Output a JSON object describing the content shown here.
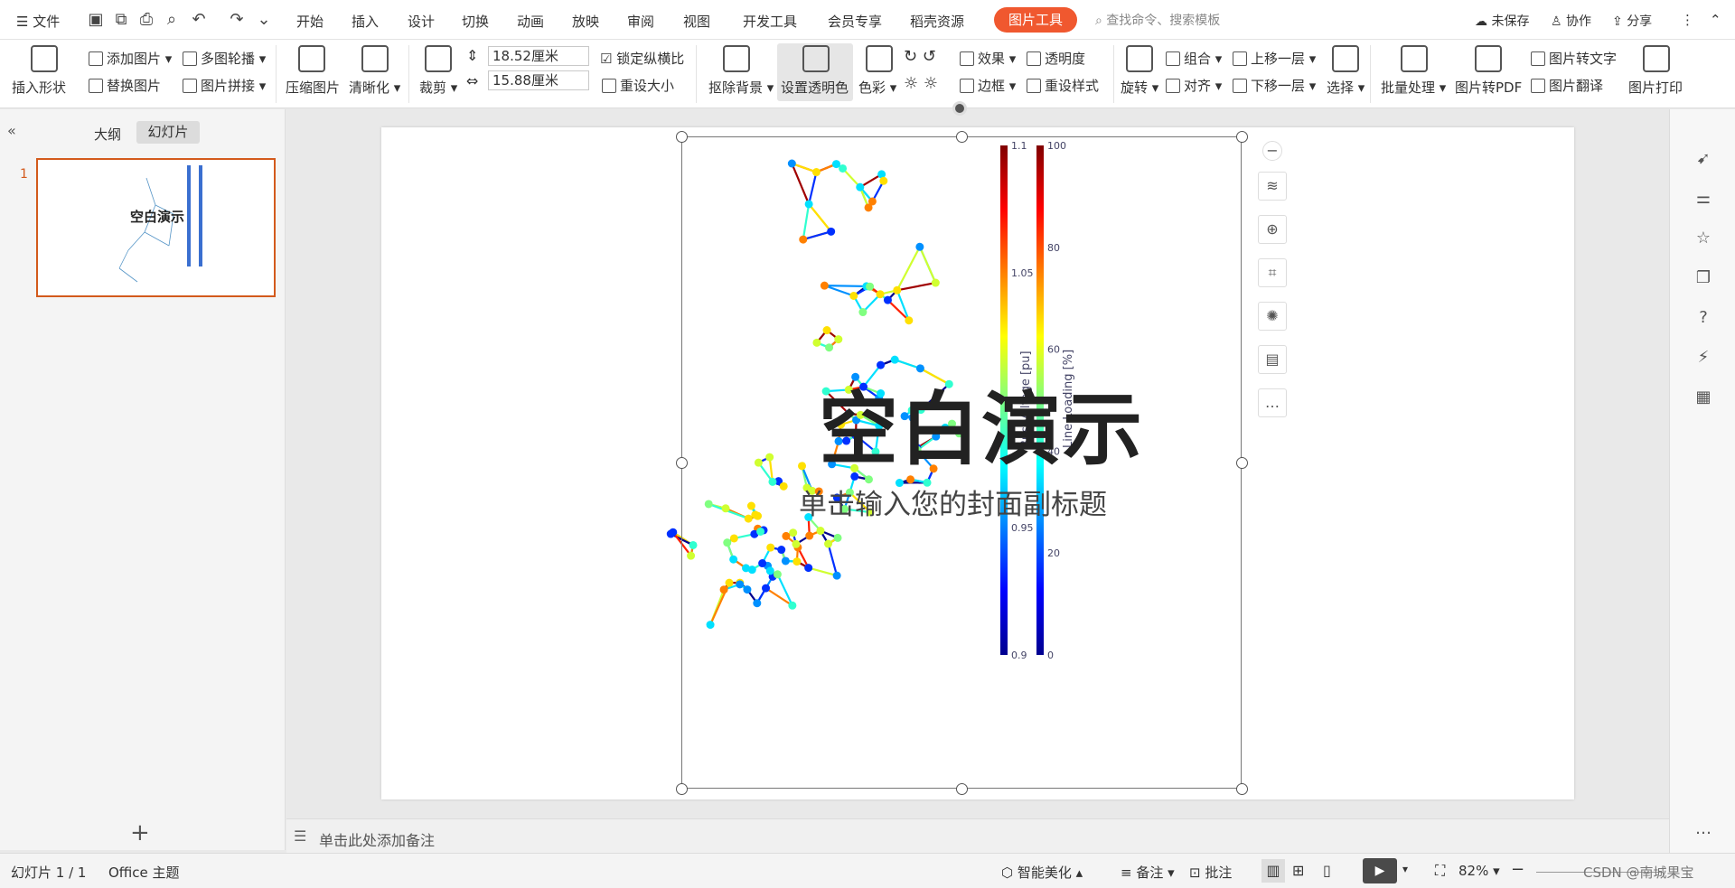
{
  "menubar": {
    "file_label": "文件",
    "tabs": [
      "开始",
      "插入",
      "设计",
      "切换",
      "动画",
      "放映",
      "审阅",
      "视图",
      "开发工具",
      "会员专享",
      "稻壳资源"
    ],
    "active_tab": "图片工具",
    "search_placeholder": "查找命令、搜索模板",
    "unsaved": "未保存",
    "collab": "协作",
    "share": "分享"
  },
  "ribbon": {
    "insert_shape": "插入形状",
    "add_picture": "添加图片",
    "multi_carousel": "多图轮播",
    "replace_picture": "替换图片",
    "picture_collage": "图片拼接",
    "compress": "压缩图片",
    "sharpen": "清晰化",
    "crop": "裁剪",
    "width_value": "18.52厘米",
    "height_value": "15.88厘米",
    "lock_ratio": "锁定纵横比",
    "reset_size": "重设大小",
    "remove_bg": "抠除背景",
    "set_transparent": "设置透明色",
    "color": "色彩",
    "effects": "效果",
    "transparency": "透明度",
    "border": "边框",
    "reset_style": "重设样式",
    "rotate": "旋转",
    "group": "组合",
    "align": "对齐",
    "bring_forward": "上移一层",
    "send_backward": "下移一层",
    "select": "选择",
    "batch": "批量处理",
    "to_pdf": "图片转PDF",
    "to_text": "图片转文字",
    "translate": "图片翻译",
    "print": "图片打印"
  },
  "leftpanel": {
    "tab_outline": "大纲",
    "tab_slides": "幻灯片",
    "slide_number": "1",
    "thumb_title": "空白演示"
  },
  "slide": {
    "title": "空白演示",
    "subtitle": "单击输入您的封面副标题"
  },
  "colorbar_voltage": {
    "label": "Bus Voltage [pu]",
    "ticks": [
      "1.1",
      "1.05",
      "1",
      "0.95",
      "0.9"
    ]
  },
  "colorbar_loading": {
    "label": "Line Loading [%]",
    "ticks": [
      "100",
      "80",
      "60",
      "40",
      "20",
      "0"
    ]
  },
  "notes": {
    "placeholder": "单击此处添加备注"
  },
  "status": {
    "slide_count": "幻灯片 1 / 1",
    "theme": "Office 主题",
    "beautify": "智能美化",
    "notes": "备注",
    "comments": "批注",
    "zoom": "82%",
    "watermark": "CSDN @南城果宝"
  }
}
